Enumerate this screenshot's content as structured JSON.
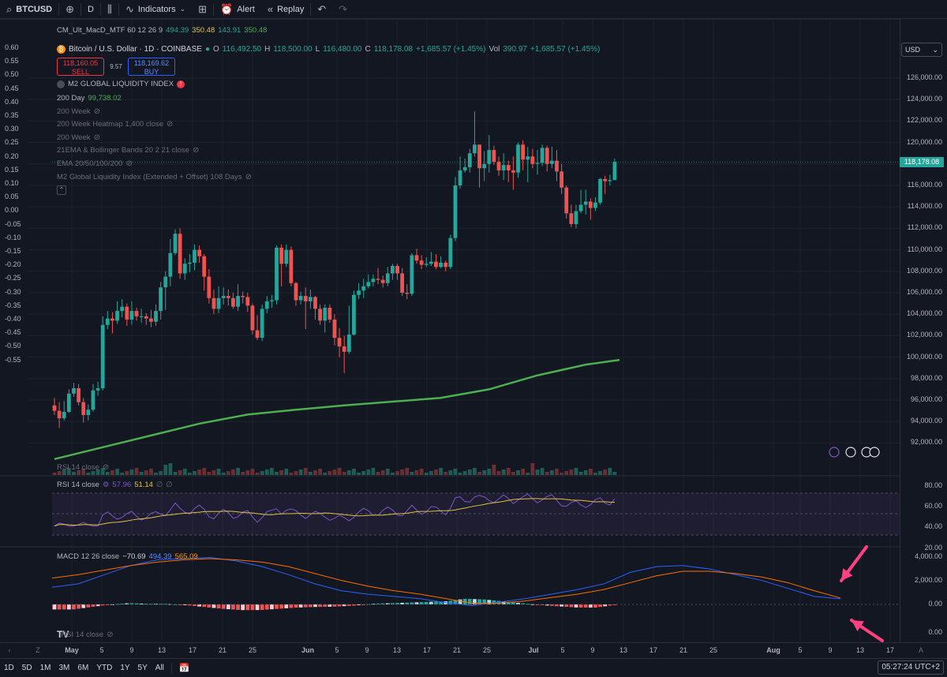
{
  "toolbar": {
    "symbol": "BTCUSD",
    "interval": "D",
    "indicators_label": "Indicators",
    "alert_label": "Alert",
    "replay_label": "Replay"
  },
  "indicator_top": {
    "name": "CM_Ult_MacD_MTF 60 12 26 9",
    "v1": "494.39",
    "v2": "350.48",
    "v3": "143.91",
    "v4": "350.48"
  },
  "symbol_info": {
    "title": "Bitcoin / U.S. Dollar · 1D · COINBASE",
    "o_label": "O",
    "o": "116,492.50",
    "h_label": "H",
    "h": "118,500.00",
    "l_label": "L",
    "l": "116,480.00",
    "c_label": "C",
    "c": "118,178.08",
    "change": "+1,685.57 (+1.45%)",
    "vol_label": "Vol",
    "vol": "390.97",
    "change2": "+1,685.57 (+1.45%)"
  },
  "trade": {
    "sell_price": "118,160.05",
    "sell_label": "SELL",
    "spread": "9.57",
    "buy_price": "118,169.62",
    "buy_label": "BUY"
  },
  "legend_items": [
    {
      "name": "M2 GLOBAL LIQUIDITY INDEX",
      "value": ""
    },
    {
      "name": "200 Day",
      "value": "99,738.02"
    },
    {
      "name": "200 Week",
      "value": ""
    },
    {
      "name": "200 Week Heatmap 1,400 close",
      "value": ""
    },
    {
      "name": "200 Week",
      "value": ""
    },
    {
      "name": "21EMA & Bollinger Bands 20 2 21 close",
      "value": ""
    },
    {
      "name": "EMA 20/50/100/200",
      "value": ""
    },
    {
      "name": "M2 Global Liquidity Index (Extended + Offset) 108 Days",
      "value": ""
    }
  ],
  "left_axis": [
    "0.60",
    "0.55",
    "0.50",
    "0.45",
    "0.40",
    "0.35",
    "0.30",
    "0.25",
    "0.20",
    "0.15",
    "0.10",
    "0.05",
    "0.00",
    "-0.05",
    "-0.10",
    "-0.15",
    "-0.20",
    "-0.25",
    "-0.30",
    "-0.35",
    "-0.40",
    "-0.45",
    "-0.50",
    "-0.55"
  ],
  "price_axis": {
    "currency": "USD",
    "ticks": [
      "126,000.00",
      "124,000.00",
      "122,000.00",
      "120,000.00",
      "118,000.00",
      "116,000.00",
      "114,000.00",
      "112,000.00",
      "110,000.00",
      "108,000.00",
      "106,000.00",
      "104,000.00",
      "102,000.00",
      "100,000.00",
      "98,000.00",
      "96,000.00",
      "94,000.00",
      "92,000.00"
    ],
    "last_price": "118,178.08"
  },
  "rsi_legend_top": "RSI 14 close",
  "rsi": {
    "label": "RSI 14 close",
    "v1": "57.96",
    "v2": "51.14",
    "ticks": [
      "80.00",
      "60.00",
      "40.00",
      "20.00"
    ]
  },
  "macd": {
    "label": "MACD 12 26 close",
    "v1": "−70.69",
    "v2": "494.39",
    "v3": "565.09",
    "ticks": [
      "4,000.00",
      "2,000.00",
      "0.00"
    ]
  },
  "rsi_bottom_label": "RSI 14 close",
  "macd_extra_tick": "0.00",
  "time_axis": [
    "May",
    "5",
    "9",
    "13",
    "17",
    "21",
    "25",
    "Jun",
    "5",
    "9",
    "13",
    "17",
    "21",
    "25",
    "Jul",
    "5",
    "9",
    "13",
    "17",
    "21",
    "25",
    "Aug",
    "5",
    "9",
    "13",
    "17"
  ],
  "bottom_ranges": [
    "1D",
    "5D",
    "1M",
    "3M",
    "6M",
    "YTD",
    "1Y",
    "5Y",
    "All"
  ],
  "clock": "05:27:24 UTC+2",
  "colors": {
    "up": "#26a69a",
    "down": "#ef5350",
    "ma200": "#4caf50",
    "rsi_line": "#7e57c2",
    "rsi_ma": "#e0c341",
    "macd_line": "#2962ff",
    "signal_line": "#ff6d00",
    "arrow": "#ff4081"
  },
  "chart_data": {
    "type": "candlestick",
    "title": "Bitcoin / U.S. Dollar · 1D · COINBASE",
    "ylim": [
      90500,
      127500
    ],
    "candles": [
      [
        95500,
        95000,
        96200,
        94600
      ],
      [
        95000,
        94300,
        95800,
        93400
      ],
      [
        94300,
        94900,
        95900,
        94100
      ],
      [
        94900,
        96600,
        97000,
        94800
      ],
      [
        96600,
        97100,
        97600,
        96300
      ],
      [
        97100,
        95800,
        97500,
        95500
      ],
      [
        95800,
        94600,
        96200,
        93900
      ],
      [
        94600,
        95100,
        95600,
        94100
      ],
      [
        95100,
        96900,
        97500,
        94900
      ],
      [
        96900,
        97100,
        97700,
        96400
      ],
      [
        97100,
        103000,
        103800,
        96900
      ],
      [
        103000,
        103600,
        104300,
        102600
      ],
      [
        103600,
        103400,
        104200,
        102200
      ],
      [
        103400,
        104300,
        105200,
        103100
      ],
      [
        104300,
        104700,
        105400,
        103700
      ],
      [
        104700,
        103500,
        105000,
        102900
      ],
      [
        103500,
        104300,
        105200,
        103000
      ],
      [
        104300,
        103800,
        104600,
        103400
      ],
      [
        103800,
        103800,
        104500,
        103200
      ],
      [
        103800,
        103600,
        104100,
        103000
      ],
      [
        103600,
        103300,
        104400,
        102800
      ],
      [
        103300,
        104300,
        104900,
        102900
      ],
      [
        104300,
        106500,
        107000,
        103500
      ],
      [
        106500,
        107500,
        108000,
        104400
      ],
      [
        107500,
        109700,
        111000,
        106600
      ],
      [
        109700,
        111500,
        111900,
        109500
      ],
      [
        111500,
        107800,
        112000,
        107300
      ],
      [
        107800,
        108700,
        109200,
        107200
      ],
      [
        108700,
        108800,
        109600,
        107900
      ],
      [
        108800,
        110000,
        110500,
        108100
      ],
      [
        110000,
        109400,
        110400,
        108800
      ],
      [
        109400,
        107500,
        109600,
        106200
      ],
      [
        107500,
        105500,
        108200,
        105000
      ],
      [
        105500,
        104500,
        106300,
        104000
      ],
      [
        104500,
        105500,
        106600,
        104100
      ],
      [
        105500,
        105700,
        106500,
        104900
      ],
      [
        105700,
        105500,
        106300,
        104800
      ],
      [
        105500,
        104700,
        106000,
        104500
      ],
      [
        104700,
        105700,
        106800,
        104300
      ],
      [
        105700,
        105600,
        106100,
        105000
      ],
      [
        105600,
        104800,
        106000,
        104200
      ],
      [
        104800,
        102500,
        105000,
        102100
      ],
      [
        102500,
        101800,
        103900,
        101600
      ],
      [
        101800,
        104500,
        104900,
        101500
      ],
      [
        104500,
        105200,
        105700,
        104100
      ],
      [
        105200,
        105300,
        105800,
        104600
      ],
      [
        105300,
        110200,
        110400,
        104900
      ],
      [
        110200,
        108700,
        110500,
        106600
      ],
      [
        108700,
        110000,
        110500,
        108400
      ],
      [
        110000,
        106900,
        110300,
        106600
      ],
      [
        106900,
        105300,
        107000,
        104800
      ],
      [
        105300,
        105700,
        106100,
        104900
      ],
      [
        105700,
        105200,
        106500,
        102600
      ],
      [
        105200,
        105600,
        106300,
        104500
      ],
      [
        105600,
        104500,
        105700,
        103500
      ],
      [
        104500,
        103400,
        104900,
        103000
      ],
      [
        103400,
        104600,
        104900,
        102300
      ],
      [
        104600,
        103500,
        104900,
        103200
      ],
      [
        103500,
        101800,
        104000,
        101100
      ],
      [
        101800,
        101000,
        102700,
        100000
      ],
      [
        101000,
        100500,
        102000,
        98500
      ],
      [
        100500,
        102100,
        104800,
        100300
      ],
      [
        102100,
        105800,
        106200,
        102000
      ],
      [
        105800,
        106200,
        106900,
        105400
      ],
      [
        106200,
        106600,
        107300,
        105500
      ],
      [
        106600,
        107000,
        107700,
        106400
      ],
      [
        107000,
        107300,
        107700,
        106600
      ],
      [
        107300,
        107200,
        108300,
        106800
      ],
      [
        107200,
        106900,
        107600,
        106500
      ],
      [
        106900,
        107800,
        108400,
        106600
      ],
      [
        107800,
        108500,
        108700,
        107200
      ],
      [
        108500,
        107800,
        108700,
        107200
      ],
      [
        107800,
        106000,
        108300,
        105700
      ],
      [
        106000,
        105900,
        106800,
        105400
      ],
      [
        105900,
        109500,
        109700,
        105700
      ],
      [
        109500,
        109000,
        110100,
        108700
      ],
      [
        109000,
        108600,
        109500,
        108200
      ],
      [
        108600,
        108700,
        109300,
        108400
      ],
      [
        108700,
        108900,
        109800,
        108500
      ],
      [
        108900,
        108400,
        109600,
        108200
      ],
      [
        108400,
        108800,
        109400,
        108300
      ],
      [
        108800,
        108400,
        109000,
        108000
      ],
      [
        108400,
        111100,
        111400,
        108200
      ],
      [
        111100,
        116000,
        116800,
        110800
      ],
      [
        116000,
        117400,
        118700,
        115700
      ],
      [
        117400,
        117700,
        118500,
        117200
      ],
      [
        117700,
        119000,
        119400,
        117200
      ],
      [
        119000,
        119800,
        122900,
        118700
      ],
      [
        119800,
        117600,
        119800,
        115800
      ],
      [
        117600,
        118000,
        119200,
        116400
      ],
      [
        118000,
        119300,
        120700,
        117200
      ],
      [
        119300,
        118200,
        119700,
        117900
      ],
      [
        118200,
        117400,
        118700,
        116900
      ],
      [
        117400,
        117900,
        119000,
        116500
      ],
      [
        117900,
        117400,
        118300,
        116300
      ],
      [
        117400,
        117200,
        118700,
        115600
      ],
      [
        117200,
        119800,
        120000,
        116700
      ],
      [
        119800,
        118400,
        120200,
        117400
      ],
      [
        118400,
        118700,
        119600,
        116300
      ],
      [
        118700,
        118000,
        119400,
        117600
      ],
      [
        118000,
        118100,
        119300,
        117000
      ],
      [
        118100,
        119500,
        119800,
        117800
      ],
      [
        119500,
        118000,
        119700,
        117300
      ],
      [
        118000,
        118300,
        119600,
        117600
      ],
      [
        118300,
        117300,
        119300,
        116400
      ],
      [
        117300,
        115800,
        118000,
        115200
      ],
      [
        115800,
        113400,
        116000,
        112900
      ],
      [
        113400,
        112400,
        114200,
        112100
      ],
      [
        112400,
        113600,
        114200,
        112000
      ],
      [
        113600,
        114200,
        115600,
        113400
      ],
      [
        114200,
        114500,
        115600,
        113300
      ],
      [
        114500,
        113900,
        114800,
        112800
      ],
      [
        113900,
        114400,
        114900,
        113600
      ],
      [
        114400,
        116600,
        116700,
        114200
      ],
      [
        116600,
        116400,
        116900,
        115200
      ],
      [
        116400,
        116500,
        117000,
        116000
      ],
      [
        116500,
        118200,
        118500,
        116500
      ]
    ],
    "ma200": [
      [
        0,
        90500
      ],
      [
        10,
        91600
      ],
      [
        20,
        92700
      ],
      [
        30,
        93800
      ],
      [
        40,
        94650
      ],
      [
        50,
        95100
      ],
      [
        60,
        95500
      ],
      [
        70,
        95850
      ],
      [
        80,
        96200
      ],
      [
        90,
        97000
      ],
      [
        100,
        98300
      ],
      [
        110,
        99300
      ],
      [
        117,
        99738
      ]
    ]
  }
}
